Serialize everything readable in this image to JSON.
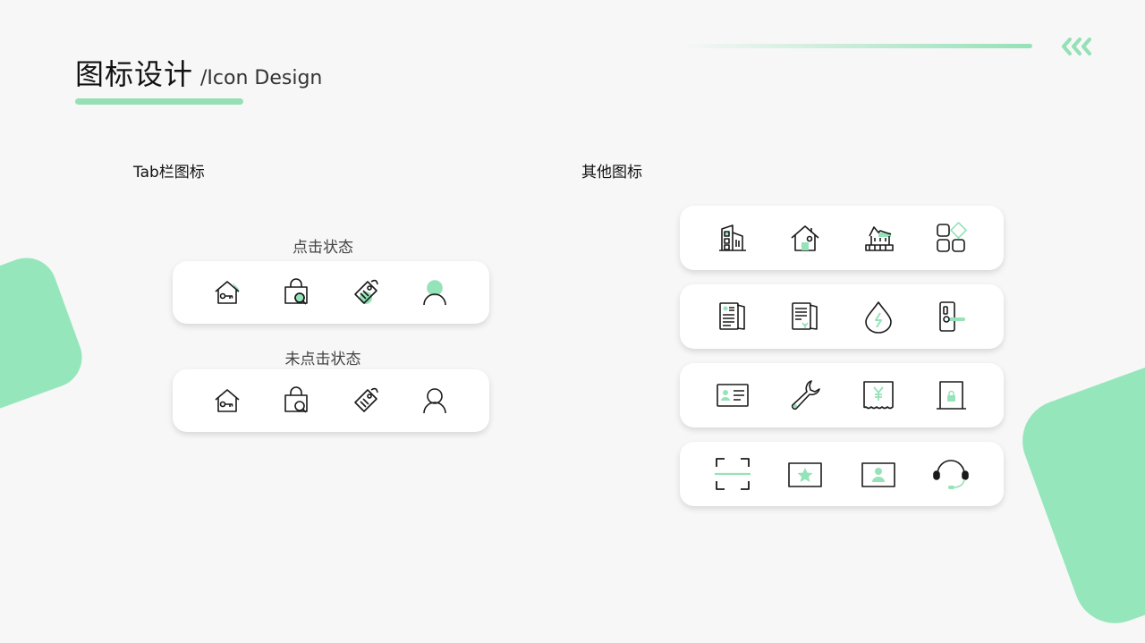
{
  "header": {
    "title_cn": "图标设计",
    "title_en": "/Icon Design"
  },
  "tab_section": {
    "label": "Tab栏图标",
    "clicked_label": "点击状态",
    "unclicked_label": "未点击状态",
    "icons": [
      "house-key-icon",
      "bag-search-icon",
      "price-tag-icon",
      "user-icon"
    ]
  },
  "other_section": {
    "label": "其他图标",
    "rows": [
      [
        "buildings-icon",
        "house-icon",
        "villa-icon",
        "apps-grid-icon"
      ],
      [
        "documents-icon",
        "contract-icon",
        "water-drop-icon",
        "door-lock-icon"
      ],
      [
        "id-card-icon",
        "wrench-icon",
        "yuan-receipt-icon",
        "locked-door-icon"
      ],
      [
        "scan-frame-icon",
        "star-card-icon",
        "photo-id-icon",
        "headset-icon"
      ]
    ]
  },
  "colors": {
    "accent": "#95e3b8",
    "background": "#f7f7f7",
    "card": "#ffffff",
    "stroke": "#1a1a1a"
  }
}
